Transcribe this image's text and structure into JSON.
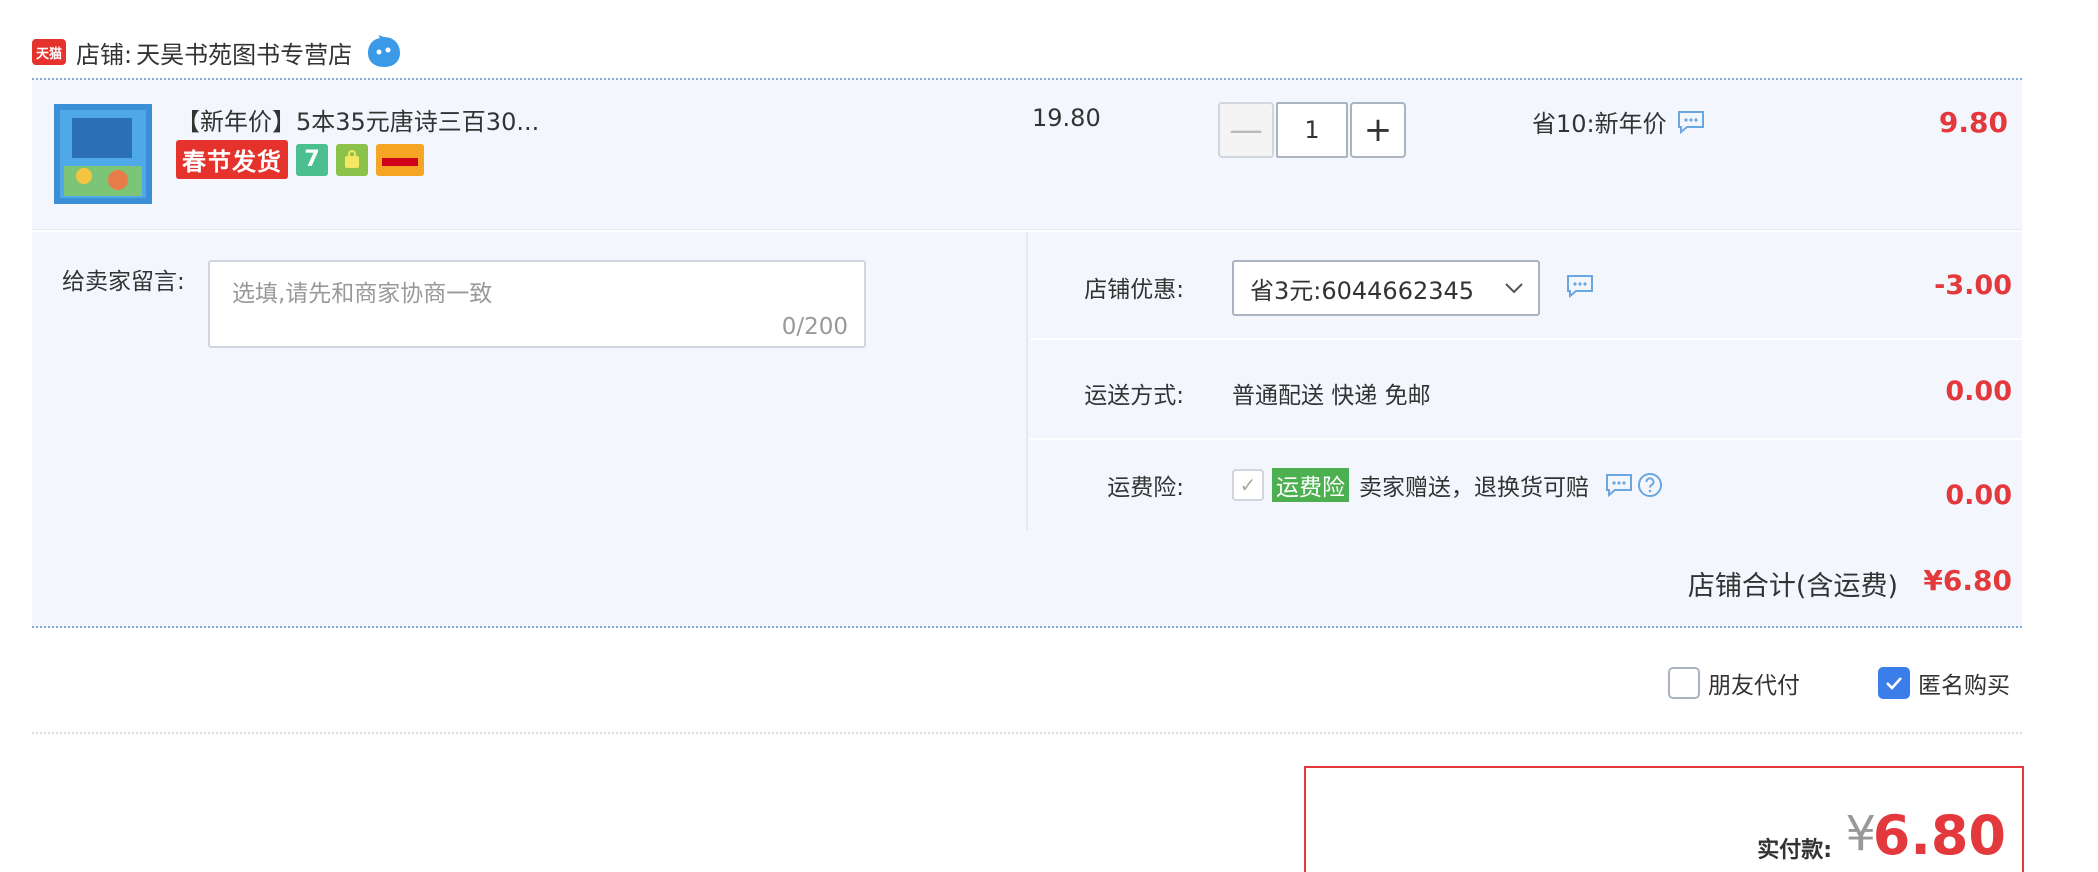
{
  "shop": {
    "logo_text": "天猫",
    "label": "店铺:",
    "name": "天昊书苑图书专营店"
  },
  "item": {
    "title": "【新年价】5本35元唐诗三百30...",
    "badge_spring": "春节发货",
    "badge_seven": "7",
    "unit_price": "19.80",
    "quantity": "1",
    "qty_minus": "—",
    "qty_plus": "+",
    "promo": "省10:新年价",
    "total": "9.80"
  },
  "message": {
    "label": "给卖家留言:",
    "placeholder": "选填,请先和商家协商一致",
    "count": "0/200"
  },
  "coupon": {
    "label": "店铺优惠:",
    "selected": "省3元:6044662345",
    "value": "-3.00"
  },
  "shipping": {
    "label": "运送方式:",
    "text": "普通配送 快递 免邮",
    "value": "0.00"
  },
  "insurance": {
    "label": "运费险:",
    "tag": "运费险",
    "text": "卖家赠送，退换货可赔",
    "value": "0.00"
  },
  "shop_total": {
    "label": "店铺合计(含运费)",
    "value": "¥6.80"
  },
  "options": {
    "friend_pay": "朋友代付",
    "friend_pay_checked": false,
    "anonymous": "匿名购买",
    "anonymous_checked": true
  },
  "payment": {
    "label": "实付款:",
    "currency": "¥",
    "amount": "6.80"
  },
  "colors": {
    "accent_red": "#e4393c",
    "panel_bg": "#f3f7fd",
    "check_blue": "#3c7ee9",
    "insurance_green": "#4caf50"
  }
}
